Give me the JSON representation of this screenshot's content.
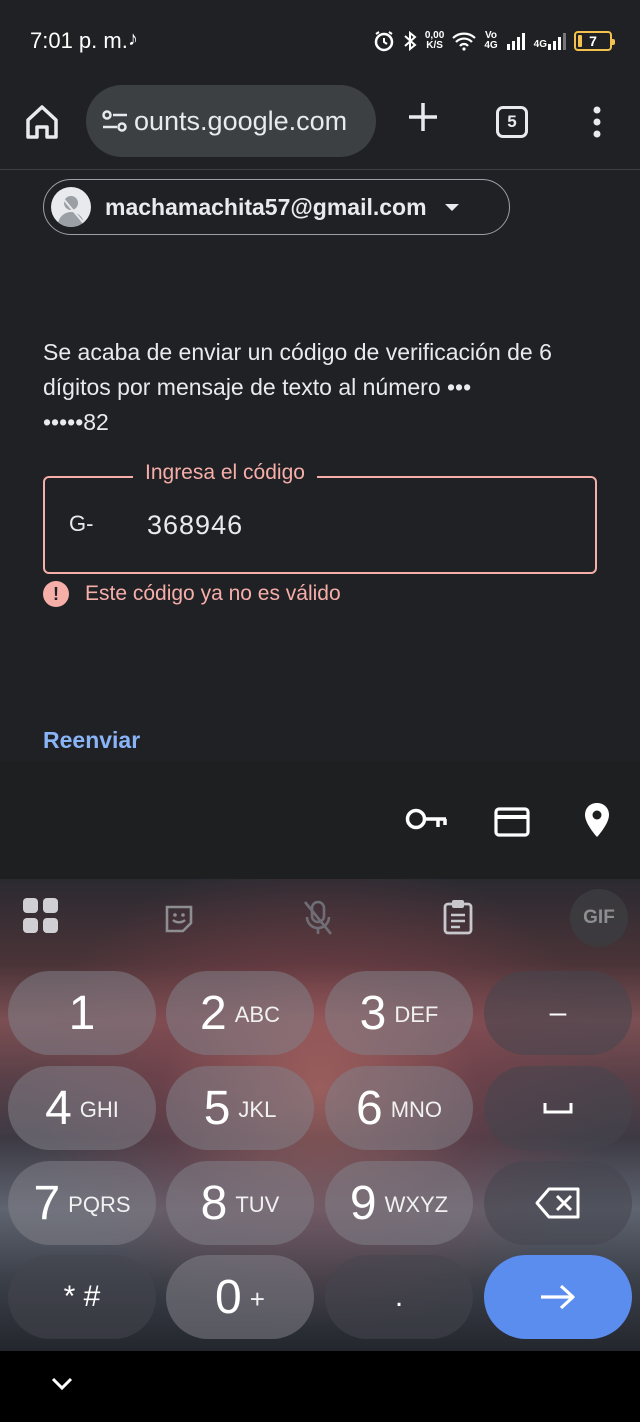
{
  "status_bar": {
    "time": "7:01 p. m.",
    "net_speed_value": "0,00",
    "net_speed_unit": "K/S",
    "volte_top": "Vo",
    "volte_bottom": "4G",
    "network_type": "4G",
    "battery_level": "7"
  },
  "browser": {
    "url": "ounts.google.com",
    "tab_count": "5"
  },
  "account": {
    "email": "machamachita57@gmail.com"
  },
  "verification": {
    "message": "Se acaba de enviar un código de verificación de 6 dígitos por mensaje de texto al número •••\n•••••82",
    "code_label": "Ingresa el código",
    "code_prefix": "G-",
    "code_value": "368946",
    "error_text": "Este código ya no es válido",
    "resend_label": "Reenviar"
  },
  "keyboard": {
    "gif_label": "GIF",
    "keys": [
      {
        "digit": "1",
        "letters": ""
      },
      {
        "digit": "2",
        "letters": "ABC"
      },
      {
        "digit": "3",
        "letters": "DEF"
      },
      {
        "digit": "4",
        "letters": "GHI"
      },
      {
        "digit": "5",
        "letters": "JKL"
      },
      {
        "digit": "6",
        "letters": "MNO"
      },
      {
        "digit": "7",
        "letters": "PQRS"
      },
      {
        "digit": "8",
        "letters": "TUV"
      },
      {
        "digit": "9",
        "letters": "WXYZ"
      },
      {
        "digit": "0",
        "letters": "+"
      }
    ],
    "symbols_label": "* #",
    "period_label": ".",
    "dash_label": "–"
  },
  "colors": {
    "error": "#f6aea9",
    "link": "#8ab4f8",
    "enter_key": "#5b8def",
    "battery": "#f2c14e"
  }
}
